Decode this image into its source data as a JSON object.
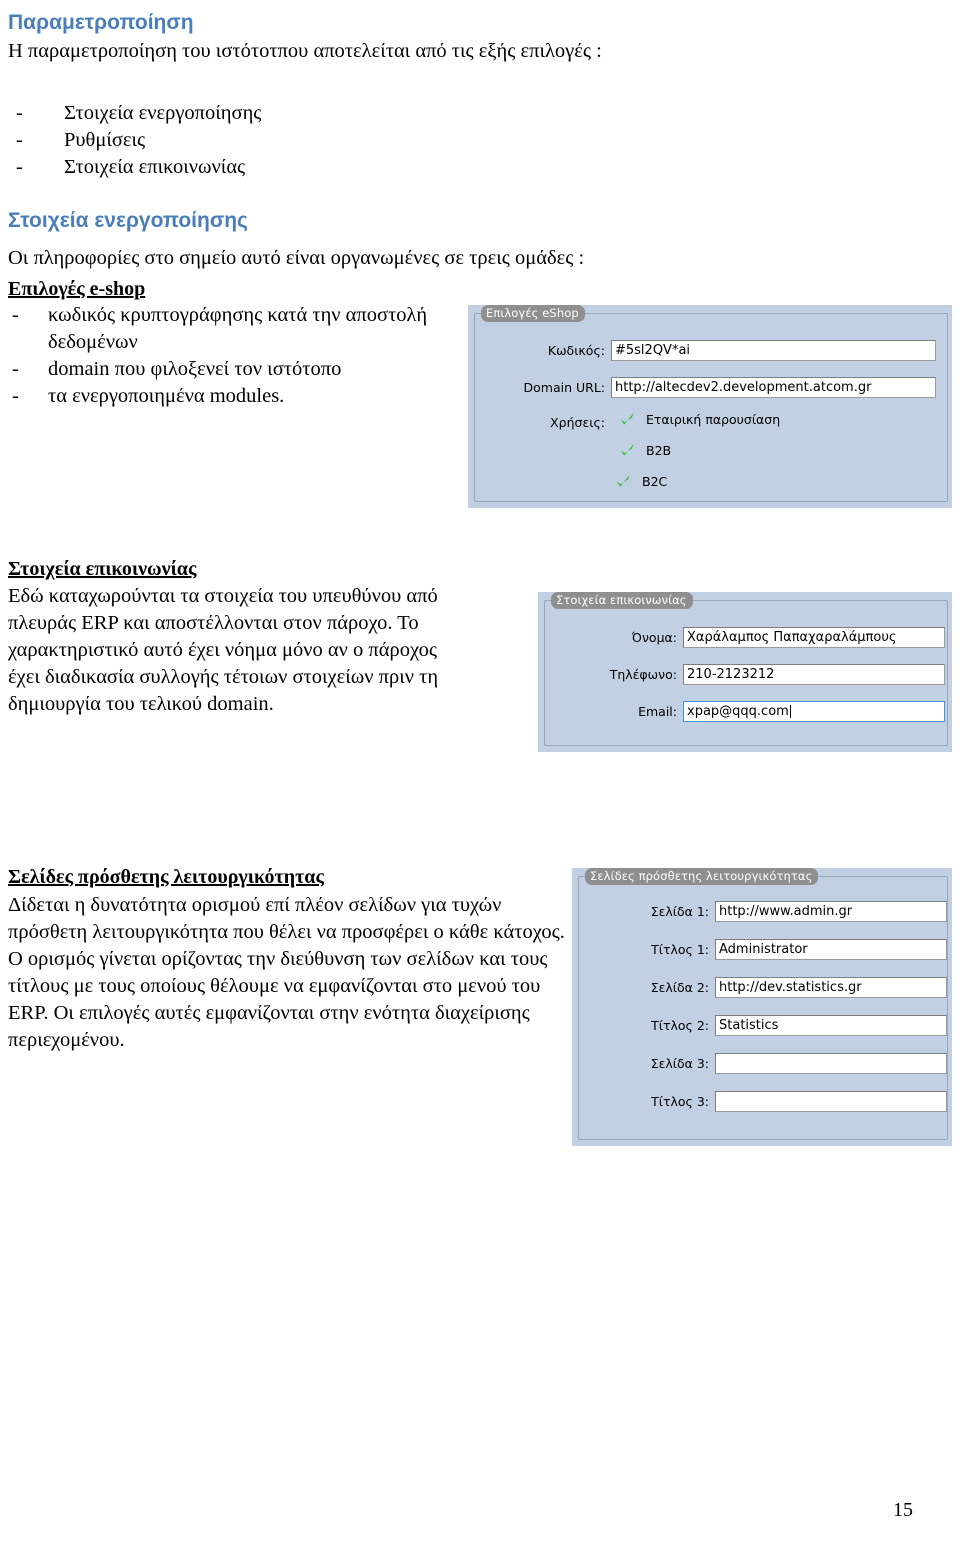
{
  "document": {
    "title": "Παραμετροποίηση",
    "intro": "Η παραμετροποίηση του ιστότοτπου αποτελείται από τις εξής επιλογές :",
    "options": [
      "Στοιχεία ενεργοποίησης",
      "Ρυθμίσεις",
      "Στοιχεία επικοινωνίας"
    ],
    "dash": "-",
    "activation": {
      "heading": "Στοιχεία ενεργοποίησης",
      "intro": "Οι πληροφορίες στο σημείο αυτό είναι οργανωμένες σε τρεις ομάδες :",
      "eshop_heading": "Επιλογές e-shop",
      "eshop_items": [
        "κωδικός κρυπτογράφησης κατά την αποστολή δεδομένων",
        "domain που φιλοξενεί τον ιστότοπο",
        "τα ενεργοποιημένα modules."
      ]
    },
    "contact": {
      "heading": "Στοιχεία επικοινωνίας",
      "paragraph": "Εδώ καταχωρούνται τα στοιχεία του υπευθύνου από πλευράς ERP και αποστέλλονται στον πάροχο. Το χαρακτηριστικό αυτό έχει νόημα μόνο αν ο πάροχος έχει διαδικασία συλλογής τέτοιων στοιχείων πριν τη δημιουργία του τελικού domain."
    },
    "extra_pages": {
      "heading": "Σελίδες πρόσθετης λειτουργικότητας",
      "paragraph": "Δίδεται η δυνατότητα ορισμού επί πλέον σελίδων για τυχών πρόσθετη λειτουργικότητα που θέλει να προσφέρει ο κάθε κάτοχος. Ο ορισμός γίνεται ορίζοντας την διεύθυνση των σελίδων και τους τίτλους με τους οποίους θέλουμε να εμφανίζονται στο μενού του ERP. Οι επιλογές αυτές εμφανίζονται στην ενότητα διαχείρισης περιεχομένου."
    },
    "page_number": "15"
  },
  "screenshots": {
    "eshop": {
      "group_title": "Επιλογές eShop",
      "fields": [
        {
          "label": "Κωδικός:",
          "value": "#5sl2QV*ai"
        },
        {
          "label": "Domain URL:",
          "value": "http://altecdev2.development.atcom.gr"
        }
      ],
      "uses_label": "Χρήσεις:",
      "uses": [
        "Εταιρική παρουσίαση",
        "B2B",
        "B2C"
      ],
      "check_color": "#33bb33"
    },
    "contact": {
      "group_title": "Στοιχεία επικοινωνίας",
      "fields": [
        {
          "label": "Όνομα:",
          "value": "Χαράλαμπος Παπαχαραλάμπους"
        },
        {
          "label": "Τηλέφωνο:",
          "value": "210-2123212"
        },
        {
          "label": "Email:",
          "value": "xpap@qqq.com"
        }
      ]
    },
    "pages": {
      "group_title": "Σελίδες πρόσθετης λειτουργικότητας",
      "fields": [
        {
          "label": "Σελίδα 1:",
          "value": "http://www.admin.gr"
        },
        {
          "label": "Τίτλος 1:",
          "value": "Administrator"
        },
        {
          "label": "Σελίδα 2:",
          "value": "http://dev.statistics.gr"
        },
        {
          "label": "Τίτλος 2:",
          "value": "Statistics"
        },
        {
          "label": "Σελίδα 3:",
          "value": ""
        },
        {
          "label": "Τίτλος 3:",
          "value": ""
        }
      ]
    }
  },
  "colors": {
    "heading_blue": "#4a7ebb",
    "panel_bg": "#c2d0e4",
    "group_title_bg": "#8f8f8f",
    "check_green": "#33bb33",
    "focus_blue": "#4a90d9"
  }
}
